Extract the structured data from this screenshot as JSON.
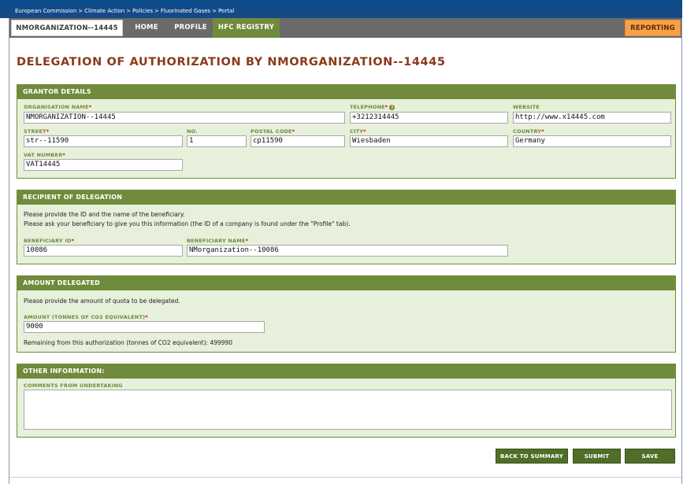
{
  "breadcrumb": [
    "European Commission",
    "Climate Action",
    "Policies",
    "Fluorinated Gases",
    "Portal"
  ],
  "breadcrumb_separator": ">",
  "nav": {
    "org": "NMORGANIZATION--14445",
    "home": "HOME",
    "profile": "PROFILE",
    "hfc": "HFC REGISTRY",
    "reporting": "REPORTING"
  },
  "page_title": "DELEGATION OF AUTHORIZATION BY NMORGANIZATION--14445",
  "grantor": {
    "header": "GRANTOR DETAILS",
    "org_name_label": "ORGANISATION NAME",
    "org_name": "NMORGANIZATION--14445",
    "telephone_label": "TELEPHONE",
    "telephone": "+3212314445",
    "website_label": "WEBSITE",
    "website": "http://www.x14445.com",
    "street_label": "STREET",
    "street": "str--11590",
    "no_label": "NO.",
    "no": "1",
    "postal_label": "POSTAL CODE",
    "postal": "cp11590",
    "city_label": "CITY",
    "city": "Wiesbaden",
    "country_label": "COUNTRY",
    "country": "Germany",
    "vat_label": "VAT NUMBER",
    "vat": "VAT14445"
  },
  "recipient": {
    "header": "RECIPIENT OF DELEGATION",
    "line1": "Please provide the ID and the name of the beneficiary.",
    "line2": "Please ask your beneficiary to give you this information (the ID of a company is found under the \"Profile\" tab).",
    "id_label": "BENEFICIARY ID",
    "id": "10086",
    "name_label": "BENEFICIARY NAME",
    "name": "NMorganization--10086"
  },
  "amount": {
    "header": "AMOUNT DELEGATED",
    "line1": "Please provide the amount of quota to be delegated.",
    "label": "AMOUNT (TONNES OF CO2 EQUIVALENT)",
    "value": "9000",
    "remaining": "Remaining from this authorization (tonnes of CO2 equivalent): 499990"
  },
  "other": {
    "header": "OTHER INFORMATION:",
    "comments_label": "COMMENTS FROM UNDERTAKING",
    "comments": ""
  },
  "buttons": {
    "back": "BACK TO SUMMARY",
    "submit": "SUBMIT",
    "save": "SAVE"
  },
  "colors": {
    "brand_blue": "#154a87",
    "panel_green": "#6f8b3b",
    "title_brown": "#8b3a1b",
    "reporting_orange": "#f7a14a"
  }
}
